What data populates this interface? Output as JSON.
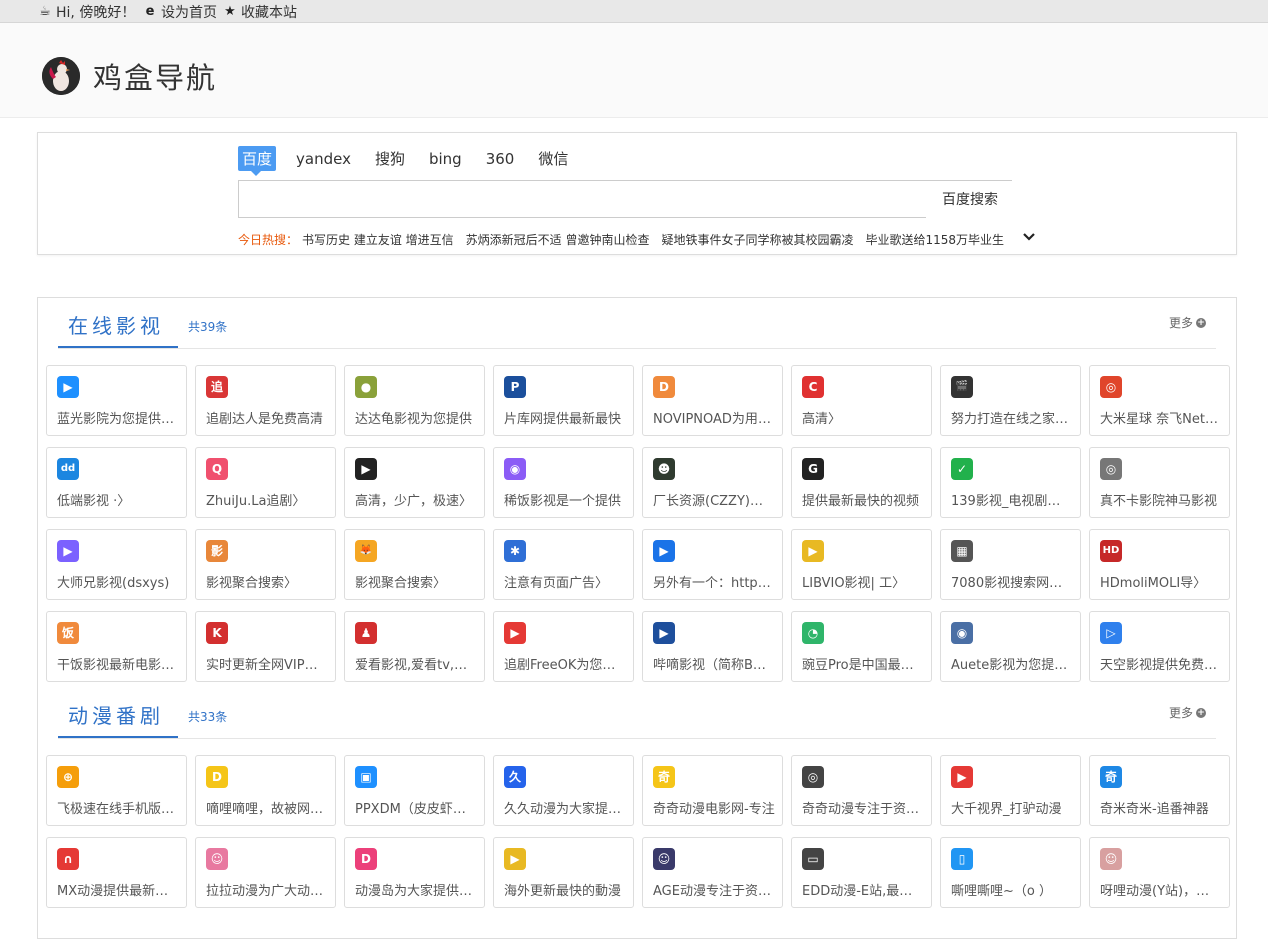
{
  "topbar": {
    "greeting": "Hi, 傍晚好！",
    "set_home": "设为首页",
    "bookmark": "收藏本站"
  },
  "site": {
    "title": "鸡盒导航"
  },
  "search": {
    "engines": [
      "百度",
      "yandex",
      "搜狗",
      "bing",
      "360",
      "微信"
    ],
    "active_engine": "百度",
    "placeholder": "",
    "button_label": "百度搜索",
    "hot_label": "今日热搜：",
    "hot_items": [
      "书写历史 建立友谊 增进互信",
      "苏炳添新冠后不适 曾邀钟南山检查",
      "疑地铁事件女子同学称被其校园霸凌",
      "毕业歌送给1158万毕业生"
    ]
  },
  "colors": {
    "accent": "#3072c7",
    "hot": "#e8590c",
    "engine_active": "#4c9bf2"
  },
  "categories": [
    {
      "title": "在线影视",
      "count": "共39条",
      "more": "更多",
      "items": [
        {
          "label": "蓝光影院为您提供最新",
          "icon": "play-icon",
          "color": "#1e90ff",
          "glyph": "▶"
        },
        {
          "label": "追剧达人是免费高清",
          "icon": "drama-icon",
          "color": "#d93636",
          "glyph": "追"
        },
        {
          "label": "达达龟影视为您提供",
          "icon": "turtle-icon",
          "color": "#8aa13a",
          "glyph": "●"
        },
        {
          "label": "片库网提供最新最快",
          "icon": "pianku-icon",
          "color": "#1b4f9c",
          "glyph": "P"
        },
        {
          "label": "NOVIPNOAD为用户提供",
          "icon": "novip-icon",
          "color": "#f08a3c",
          "glyph": "D"
        },
        {
          "label": "高清〉",
          "icon": "c-icon",
          "color": "#e03131",
          "glyph": "C"
        },
        {
          "label": "努力打造在线之家影视",
          "icon": "clapper-icon",
          "color": "#333333",
          "glyph": "🎬"
        },
        {
          "label": "大米星球 奈飞Netflix",
          "icon": "planet-icon",
          "color": "#e0452b",
          "glyph": "◎"
        },
        {
          "label": "低端影视 ·〉",
          "icon": "dd-icon",
          "color": "#1c86e0",
          "glyph": "dd"
        },
        {
          "label": "ZhuiJu.La追剧〉",
          "icon": "zhuiju-icon",
          "color": "#f0506e",
          "glyph": "Q"
        },
        {
          "label": "高清，少广，极速〉",
          "icon": "film-icon",
          "color": "#222222",
          "glyph": "▶"
        },
        {
          "label": "稀饭影视是一个提供",
          "icon": "xifan-icon",
          "color": "#8b5cf6",
          "glyph": "◉"
        },
        {
          "label": "厂长资源(CZZY)为您",
          "icon": "czzy-icon",
          "color": "#2f3b2f",
          "glyph": "☻"
        },
        {
          "label": "提供最新最快的视频",
          "icon": "g-icon",
          "color": "#222222",
          "glyph": "G"
        },
        {
          "label": "139影视_电视剧免费",
          "icon": "shield-icon",
          "color": "#22b14c",
          "glyph": "✓"
        },
        {
          "label": "真不卡影院神马影视",
          "icon": "reel-icon",
          "color": "#777777",
          "glyph": "◎"
        },
        {
          "label": "大师兄影视(dsxys)",
          "icon": "cloud-play-icon",
          "color": "#7b61ff",
          "glyph": "▶"
        },
        {
          "label": "影视聚合搜索〉",
          "icon": "search-agg-icon",
          "color": "#e8873a",
          "glyph": "影"
        },
        {
          "label": "影视聚合搜索〉",
          "icon": "fox-icon",
          "color": "#f5a623",
          "glyph": "🦊"
        },
        {
          "label": "注意有页面广告〉",
          "icon": "star-icon",
          "color": "#2f6fd6",
          "glyph": "✱"
        },
        {
          "label": "另外有一个：https://",
          "icon": "cloud-icon",
          "color": "#1a73e8",
          "glyph": "▶"
        },
        {
          "label": "LIBVIO影视| 工〉",
          "icon": "libvio-icon",
          "color": "#e8b923",
          "glyph": "▶"
        },
        {
          "label": "7080影视搜索网站〉",
          "icon": "filmstrip-icon",
          "color": "#555555",
          "glyph": "▦"
        },
        {
          "label": "HDmoliMOLI导〉",
          "icon": "hd-icon",
          "color": "#c62828",
          "glyph": "HD"
        },
        {
          "label": "干饭影视最新电影电视",
          "icon": "fan-icon",
          "color": "#f08a3c",
          "glyph": "饭"
        },
        {
          "label": "实时更新全网VIP影视",
          "icon": "kkdy-icon",
          "color": "#d32f2f",
          "glyph": "K"
        },
        {
          "label": "爱看影视,爱看tv,会员",
          "icon": "person-icon",
          "color": "#d32f2f",
          "glyph": "♟"
        },
        {
          "label": "追剧FreeOK为您提供",
          "icon": "freeok-icon",
          "color": "#e53935",
          "glyph": "▶"
        },
        {
          "label": "哔嘀影视（简称BD影视",
          "icon": "tv-icon",
          "color": "#1e4f9c",
          "glyph": "▶"
        },
        {
          "label": "豌豆Pro是中国最大的",
          "icon": "pea-icon",
          "color": "#2fb56a",
          "glyph": "◔"
        },
        {
          "label": "Auete影视为您提供最",
          "icon": "globe-icon",
          "color": "#4a6fa5",
          "glyph": "◉"
        },
        {
          "label": "天空影视提供免费在线",
          "icon": "sky-icon",
          "color": "#2f80ed",
          "glyph": "▷"
        }
      ]
    },
    {
      "title": "动漫番剧",
      "count": "共33条",
      "more": "更多",
      "items": [
        {
          "label": "飞极速在线手机版动漫",
          "icon": "fjs-icon",
          "color": "#f59e0b",
          "glyph": "⊕"
        },
        {
          "label": "嘀哩嘀哩，故被网友们",
          "icon": "dilidili-icon",
          "color": "#f5c518",
          "glyph": "D"
        },
        {
          "label": "PPXDM（皮皮虾动漫）",
          "icon": "ppxdm-icon",
          "color": "#1e90ff",
          "glyph": "▣"
        },
        {
          "label": "久久动漫为大家提供最",
          "icon": "jiujiu-icon",
          "color": "#2563eb",
          "glyph": "久"
        },
        {
          "label": "奇奇动漫电影网-专注",
          "icon": "qiqi-icon",
          "color": "#f5c518",
          "glyph": "奇"
        },
        {
          "label": "奇奇动漫专注于资源收",
          "icon": "target-icon",
          "color": "#444444",
          "glyph": "◎"
        },
        {
          "label": "大千视界_打驴动漫",
          "icon": "youtube-icon",
          "color": "#e53935",
          "glyph": "▶"
        },
        {
          "label": "奇米奇米-追番神器",
          "icon": "qimi-icon",
          "color": "#1e88e5",
          "glyph": "奇"
        },
        {
          "label": "MX动漫提供最新最快",
          "icon": "mx-icon",
          "color": "#e53935",
          "glyph": "∩"
        },
        {
          "label": "拉拉动漫为广大动漫爱",
          "icon": "lala-icon",
          "color": "#e879a0",
          "glyph": "☺"
        },
        {
          "label": "动漫岛为大家提供最新",
          "icon": "d-icon",
          "color": "#ec407a",
          "glyph": "D"
        },
        {
          "label": "海外更新最快的動漫",
          "icon": "camera-icon",
          "color": "#e8b923",
          "glyph": "▶"
        },
        {
          "label": "AGE动漫专注于资源收",
          "icon": "age-icon",
          "color": "#3a3a6a",
          "glyph": "☺"
        },
        {
          "label": "EDD动漫-E站,最全的",
          "icon": "retro-tv-icon",
          "color": "#444444",
          "glyph": "▭"
        },
        {
          "label": "嘶哩嘶哩~（o ）",
          "icon": "monitor-icon",
          "color": "#2196f3",
          "glyph": "▯"
        },
        {
          "label": "呀哩动漫(Y站)，在线",
          "icon": "yali-icon",
          "color": "#d8a0a0",
          "glyph": "☺"
        }
      ]
    }
  ]
}
